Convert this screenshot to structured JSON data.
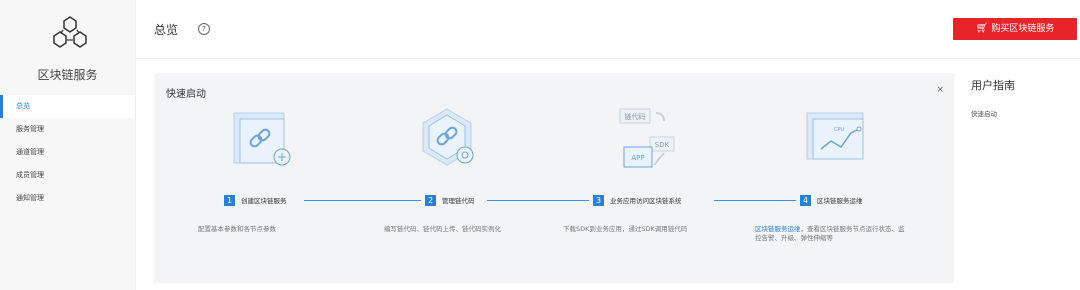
{
  "sidebar": {
    "service_name": "区块链服务",
    "items": [
      {
        "label": "总览",
        "active": true
      },
      {
        "label": "服务管理"
      },
      {
        "label": "通道管理"
      },
      {
        "label": "成员管理"
      },
      {
        "label": "通知管理"
      }
    ]
  },
  "header": {
    "title": "总览",
    "help_icon": "?",
    "buy_button": "购买区块链服务",
    "cart_icon": "cart-icon"
  },
  "quickstart": {
    "title": "快速启动",
    "close": "×",
    "steps": [
      {
        "num": "1",
        "label": "创建区块链服务",
        "desc": "配置基本参数和各节点参数"
      },
      {
        "num": "2",
        "label": "管理链代码",
        "desc": "编写链代码、链代码上传、链代码实例化"
      },
      {
        "num": "3",
        "label": "业务应用访问区块链系统",
        "desc": "下载SDK到业务应用，通过SDK调用链代码",
        "img_labels": [
          "链代码",
          "SDK",
          "APP"
        ]
      },
      {
        "num": "4",
        "label": "区块链服务运维",
        "desc_link": "区块链服务运维",
        "desc": "，查看区块链服务节点运行状态、监控告警、升级、弹性伸缩等",
        "img_label": "CPU"
      }
    ]
  },
  "guide": {
    "title": "用户指南",
    "links": [
      "快速启动"
    ]
  },
  "colors": {
    "accent": "#2a7fd7",
    "brand_red": "#e8242b"
  }
}
